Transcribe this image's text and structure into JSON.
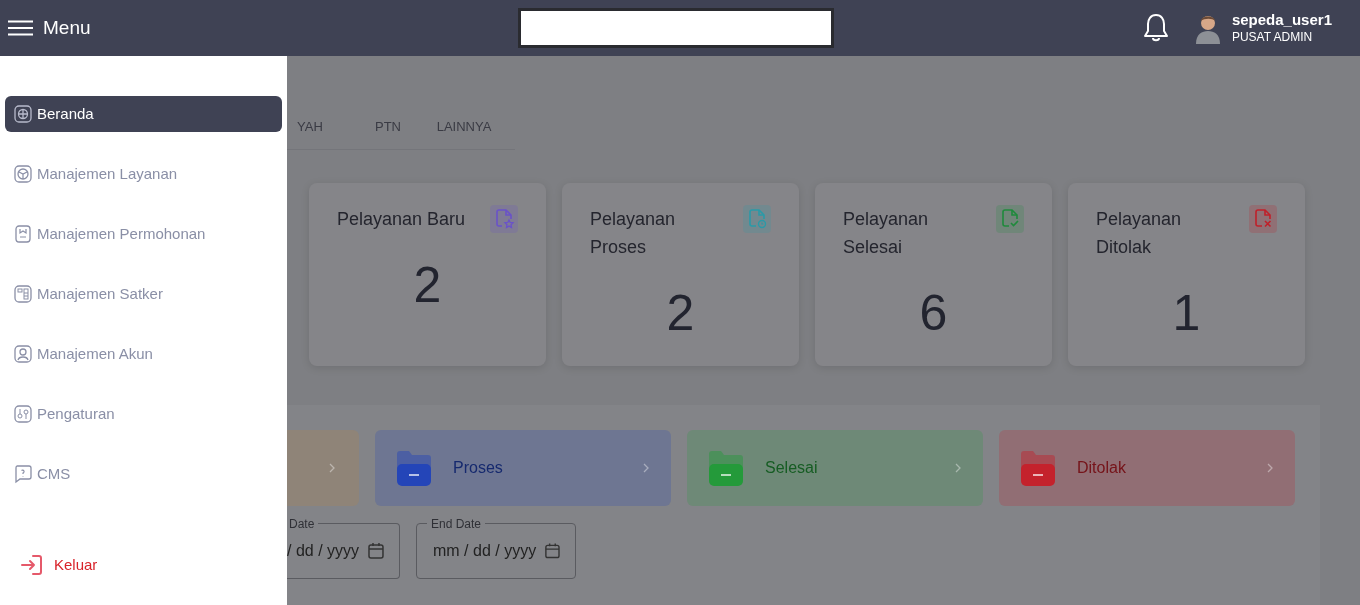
{
  "header": {
    "menu_label": "Menu",
    "user": {
      "name": "sepeda_user1",
      "role": "PUSAT ADMIN"
    }
  },
  "sidebar": {
    "items": [
      {
        "label": "Beranda",
        "selected": true,
        "kind": "grid"
      },
      {
        "label": "Manajemen Layanan",
        "selected": false,
        "kind": "box"
      },
      {
        "label": "Manajemen Permohonan",
        "selected": false,
        "kind": "form"
      },
      {
        "label": "Manajemen Satker",
        "selected": false,
        "kind": "units"
      },
      {
        "label": "Manajemen Akun",
        "selected": false,
        "kind": "user"
      },
      {
        "label": "Pengaturan",
        "selected": false,
        "kind": "sliders"
      },
      {
        "label": "CMS",
        "selected": false,
        "kind": "chat"
      }
    ],
    "logout": "Keluar"
  },
  "tabs": [
    {
      "label": "YAH"
    },
    {
      "label": "PTN"
    },
    {
      "label": "LAINNYA"
    }
  ],
  "stat_cards": [
    {
      "title": "Pelayanan Baru",
      "value": "2",
      "kind": "star",
      "color": "#6a52c9"
    },
    {
      "title": "Pelayanan Proses",
      "value": "2",
      "kind": "clock",
      "color": "#2a9aa8"
    },
    {
      "title": "Pelayanan Selesai",
      "value": "6",
      "kind": "check",
      "color": "#1f8a3c"
    },
    {
      "title": "Pelayanan Ditolak",
      "value": "1",
      "kind": "x",
      "color": "#c0202a"
    }
  ],
  "status_cards": [
    {
      "kind": "partial",
      "color": "#8f8478"
    },
    {
      "kind": "full",
      "label": "Proses",
      "color": "#2445b8"
    },
    {
      "kind": "full",
      "label": "Selesai",
      "color": "#249a3a"
    },
    {
      "kind": "full",
      "label": "Ditolak",
      "color": "#c4222c"
    }
  ],
  "date_filters": [
    {
      "label": "Date",
      "value": "/ dd / yyyy",
      "kind": "partial"
    },
    {
      "label": "End Date",
      "value": "mm / dd / yyyy",
      "kind": "full"
    }
  ]
}
